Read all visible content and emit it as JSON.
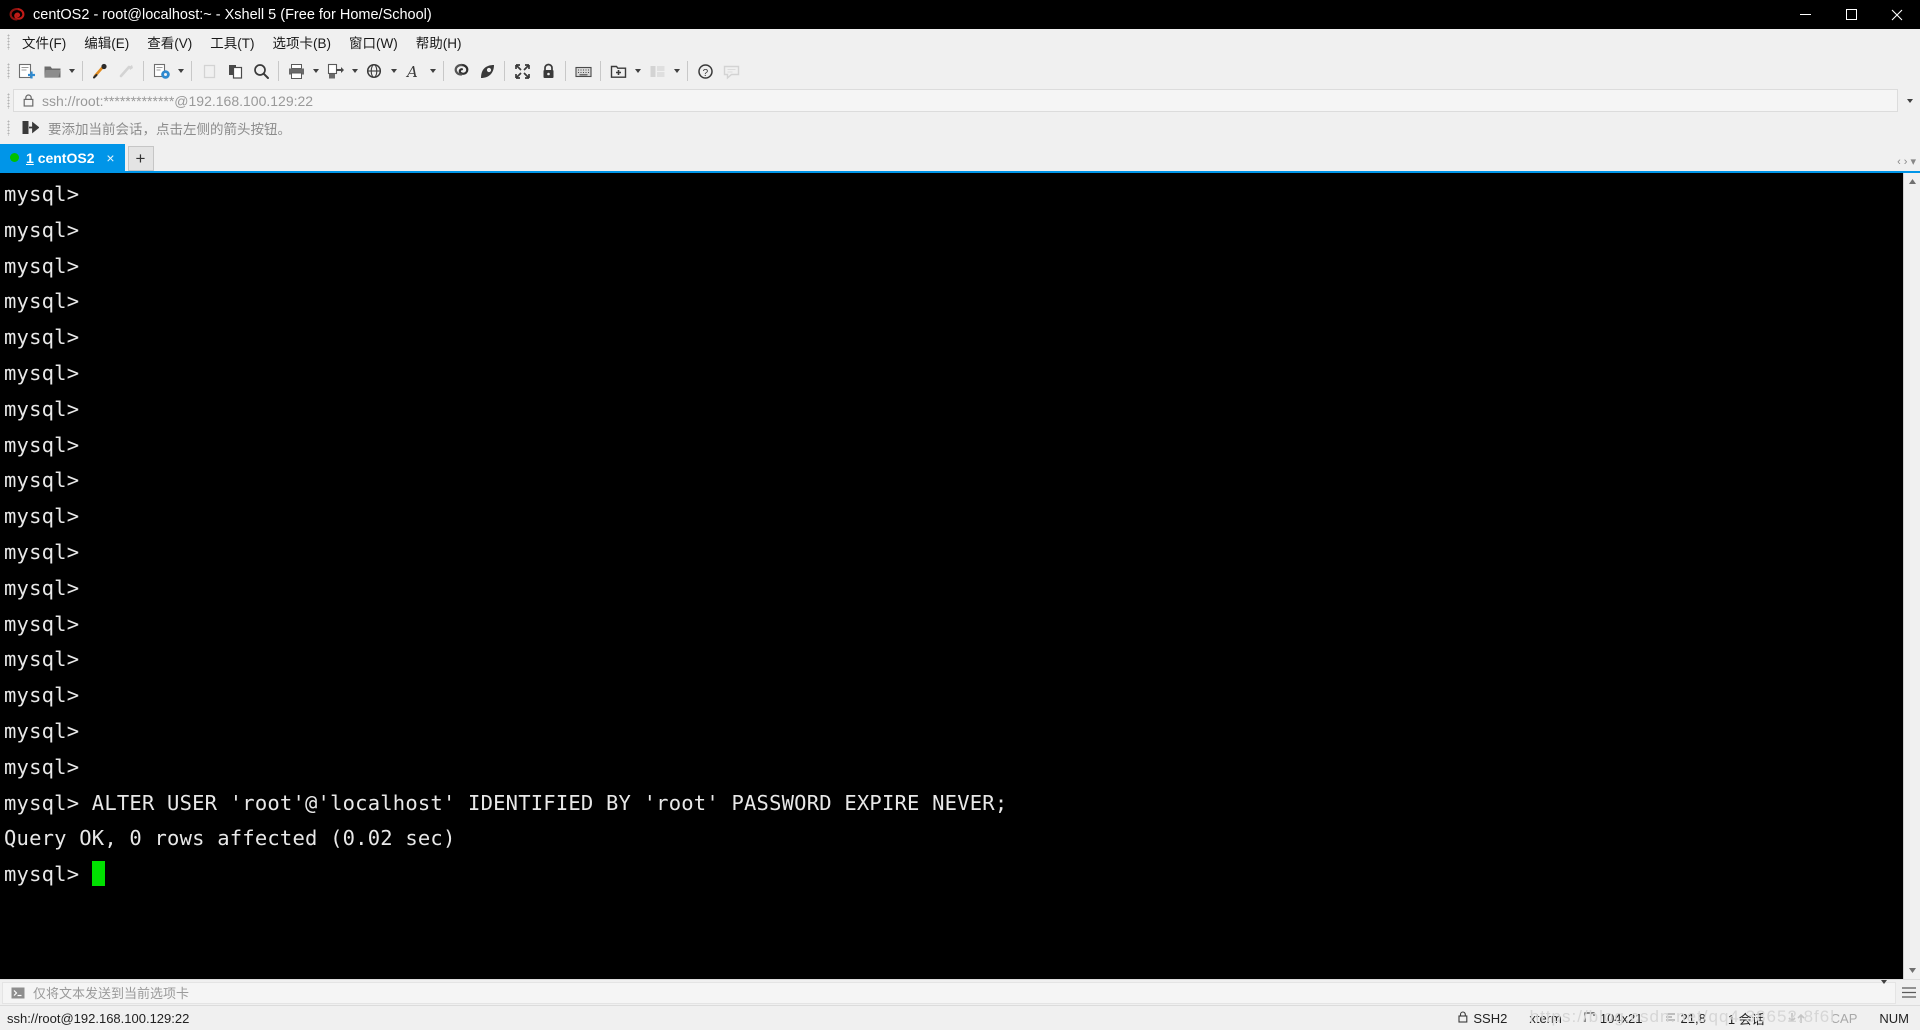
{
  "window": {
    "title": "centOS2 - root@localhost:~ - Xshell 5 (Free for Home/School)",
    "app_icon": "xshell-logo-icon",
    "minimize_label": "—",
    "maximize_label": "☐",
    "close_label": "✕"
  },
  "menubar": {
    "items": [
      {
        "label": "文件(F)",
        "name": "menu-file"
      },
      {
        "label": "编辑(E)",
        "name": "menu-edit"
      },
      {
        "label": "查看(V)",
        "name": "menu-view"
      },
      {
        "label": "工具(T)",
        "name": "menu-tools"
      },
      {
        "label": "选项卡(B)",
        "name": "menu-tabs"
      },
      {
        "label": "窗口(W)",
        "name": "menu-window"
      },
      {
        "label": "帮助(H)",
        "name": "menu-help"
      }
    ]
  },
  "toolbar": {
    "buttons": [
      "new-session-icon",
      "open-folder-icon",
      "folder-dropdown-caret",
      "connect-icon",
      "disconnect-icon",
      "session-properties-icon",
      "properties-dropdown-caret",
      "paste-clipboard-icon",
      "copy-icon",
      "find-icon",
      "print-icon",
      "print-dropdown-caret",
      "transfer-icon",
      "transfer-dropdown-caret",
      "globe-icon",
      "globe-dropdown-caret",
      "font-icon",
      "font-dropdown-caret",
      "xftp-icon",
      "xagent-icon",
      "fullscreen-icon",
      "lock-icon",
      "keyboard-icon",
      "new-folder-icon",
      "new-folder-dropdown-caret",
      "layout-icon",
      "layout-dropdown-caret",
      "help-icon",
      "comment-icon"
    ]
  },
  "address": {
    "lock_icon": "lock-icon",
    "value": "ssh://root:*************@192.168.100.129:22",
    "dropdown_icon": "chevron-down-icon"
  },
  "hint": {
    "icon": "add-session-arrow-icon",
    "text": "要添加当前会话，点击左侧的箭头按钮。"
  },
  "tabs": {
    "items": [
      {
        "index": "1",
        "title": "centOS2",
        "status_dot_color": "#00c000",
        "close_label": "×",
        "active": true
      }
    ],
    "new_tab_label": "+",
    "nav_prev": "‹",
    "nav_next": "›",
    "nav_menu": "▾",
    "active_bg": "#0095e8"
  },
  "terminal": {
    "bg_color": "#000000",
    "fg_color": "#e8e8e8",
    "cursor_color": "#00e000",
    "lines": [
      "mysql>",
      "mysql>",
      "mysql>",
      "mysql>",
      "mysql>",
      "mysql>",
      "mysql>",
      "mysql>",
      "mysql>",
      "mysql>",
      "mysql>",
      "mysql>",
      "mysql>",
      "mysql>",
      "mysql>",
      "mysql>",
      "mysql>",
      "mysql> ALTER USER 'root'@'localhost' IDENTIFIED BY 'root' PASSWORD EXPIRE NEVER;",
      "Query OK, 0 rows affected (0.02 sec)",
      "",
      "mysql> "
    ],
    "prompt_with_cursor": "mysql> "
  },
  "sendbar": {
    "icon": "terminal-prompt-icon",
    "text": "仅将文本发送到当前选项卡",
    "dropdown_icon": "chevron-down-icon",
    "menu_icon": "hamburger-menu-icon"
  },
  "statusbar": {
    "connection": "ssh://root@192.168.100.129:22",
    "cells": [
      {
        "name": "status-protocol",
        "icon": "lock-icon",
        "label": "SSH2",
        "dim": false
      },
      {
        "name": "status-terminal-type",
        "icon": "",
        "label": "xterm",
        "dim": false
      },
      {
        "name": "status-size",
        "icon": "resize-icon",
        "label": "104x21",
        "dim": false
      },
      {
        "name": "status-cursor-position",
        "icon": "cursor-icon",
        "label": "21,8",
        "dim": false
      },
      {
        "name": "status-sessions",
        "icon": "",
        "label": "1 会话",
        "dim": false
      },
      {
        "name": "status-transfer-indicator",
        "icon": "arrows-icon",
        "label": "",
        "dim": true
      },
      {
        "name": "status-caps-lock",
        "icon": "",
        "label": "CAP",
        "dim": true
      },
      {
        "name": "status-num-lock",
        "icon": "",
        "label": "NUM",
        "dim": false
      }
    ],
    "watermark": "https://blog.csdn.net/qq4.38652.8f6l"
  }
}
